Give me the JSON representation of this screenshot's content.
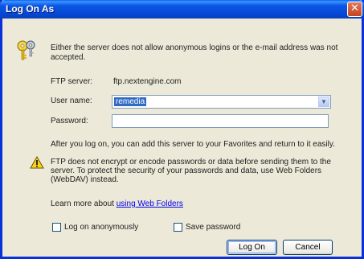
{
  "window": {
    "title": "Log On As",
    "close_glyph": "✕"
  },
  "icons": {
    "keys": "keys-icon",
    "warning": "warning-icon"
  },
  "intro": "Either the server does not allow anonymous logins or the e-mail address was not accepted.",
  "ftp_server": {
    "label": "FTP server:",
    "value": "ftp.nextengine.com"
  },
  "user_name": {
    "label": "User name:",
    "value": "remedia"
  },
  "password": {
    "label": "Password:",
    "value": ""
  },
  "after_logon_text": "After you log on, you can add this server to your Favorites and return to it easily.",
  "warning_text": "FTP does not encrypt or encode passwords or data before sending them to the server.  To protect the security of your passwords and data, use Web Folders (WebDAV) instead.",
  "learn_more": {
    "prefix": "Learn more about ",
    "link": "using Web Folders"
  },
  "checkboxes": {
    "anonymous": {
      "label": "Log on anonymously",
      "checked": false
    },
    "save_password": {
      "label": "Save password",
      "checked": false
    }
  },
  "buttons": {
    "logon": "Log On",
    "cancel": "Cancel"
  },
  "colors": {
    "title_bar": "#0548d6",
    "dialog_bg": "#ece9d8",
    "selection": "#316ac5",
    "link": "#0000ee"
  }
}
